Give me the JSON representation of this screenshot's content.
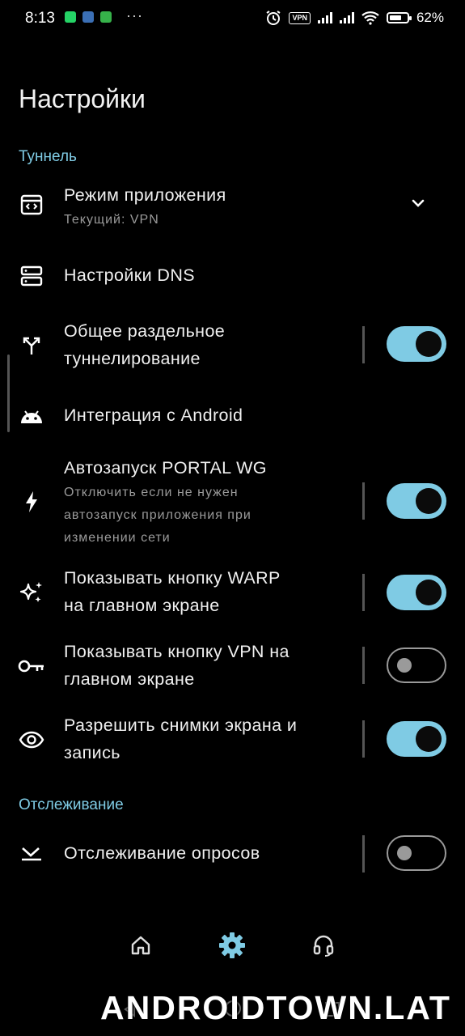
{
  "status_bar": {
    "time": "8:13",
    "more": "···",
    "vpn_label": "VPN",
    "battery_percent": "62%"
  },
  "page": {
    "title": "Настройки"
  },
  "sections": {
    "tunnel": "Туннель",
    "tracking": "Отслеживание"
  },
  "settings": {
    "app_mode": {
      "title": "Режим приложения",
      "subtitle": "Текущий: VPN",
      "icon": "app-window-icon"
    },
    "dns": {
      "title": "Настройки DNS",
      "icon": "dns-icon"
    },
    "split_tunnel": {
      "title_line1": "Общее раздельное",
      "title_line2": "туннелирование",
      "icon": "split-arrow-icon",
      "enabled": true
    },
    "android_integration": {
      "title": "Интеграция с Android",
      "icon": "android-icon"
    },
    "autostart": {
      "title": "Автозапуск PORTAL WG",
      "sub_line1": "Отключить если не нужен",
      "sub_line2": "автозапуск приложения при",
      "sub_line3": "изменении сети",
      "icon": "bolt-icon",
      "enabled": true
    },
    "warp_button": {
      "title_line1": "Показывать кнопку WARP",
      "title_line2": "на главном экране",
      "icon": "sparkle-icon",
      "enabled": true
    },
    "vpn_button": {
      "title_line1": "Показывать кнопку VPN на",
      "title_line2": "главном экране",
      "icon": "key-icon",
      "enabled": false
    },
    "screenshots": {
      "title_line1": "Разрешить снимки экрана и",
      "title_line2": "запись",
      "icon": "eye-icon",
      "enabled": true
    },
    "poll_tracking": {
      "title": "Отслеживание опросов",
      "icon": "poll-icon",
      "enabled": false
    }
  },
  "bottom_nav": {
    "items": [
      {
        "icon": "home-icon",
        "active": false
      },
      {
        "icon": "gear-icon",
        "active": true
      },
      {
        "icon": "headset-icon",
        "active": false
      }
    ]
  },
  "watermark": "ANDROIDTOWN.LAT",
  "colors": {
    "accent": "#7fcbe4",
    "background": "#000000",
    "text": "#f0f0f0",
    "secondary_text": "#9a9a9a"
  }
}
